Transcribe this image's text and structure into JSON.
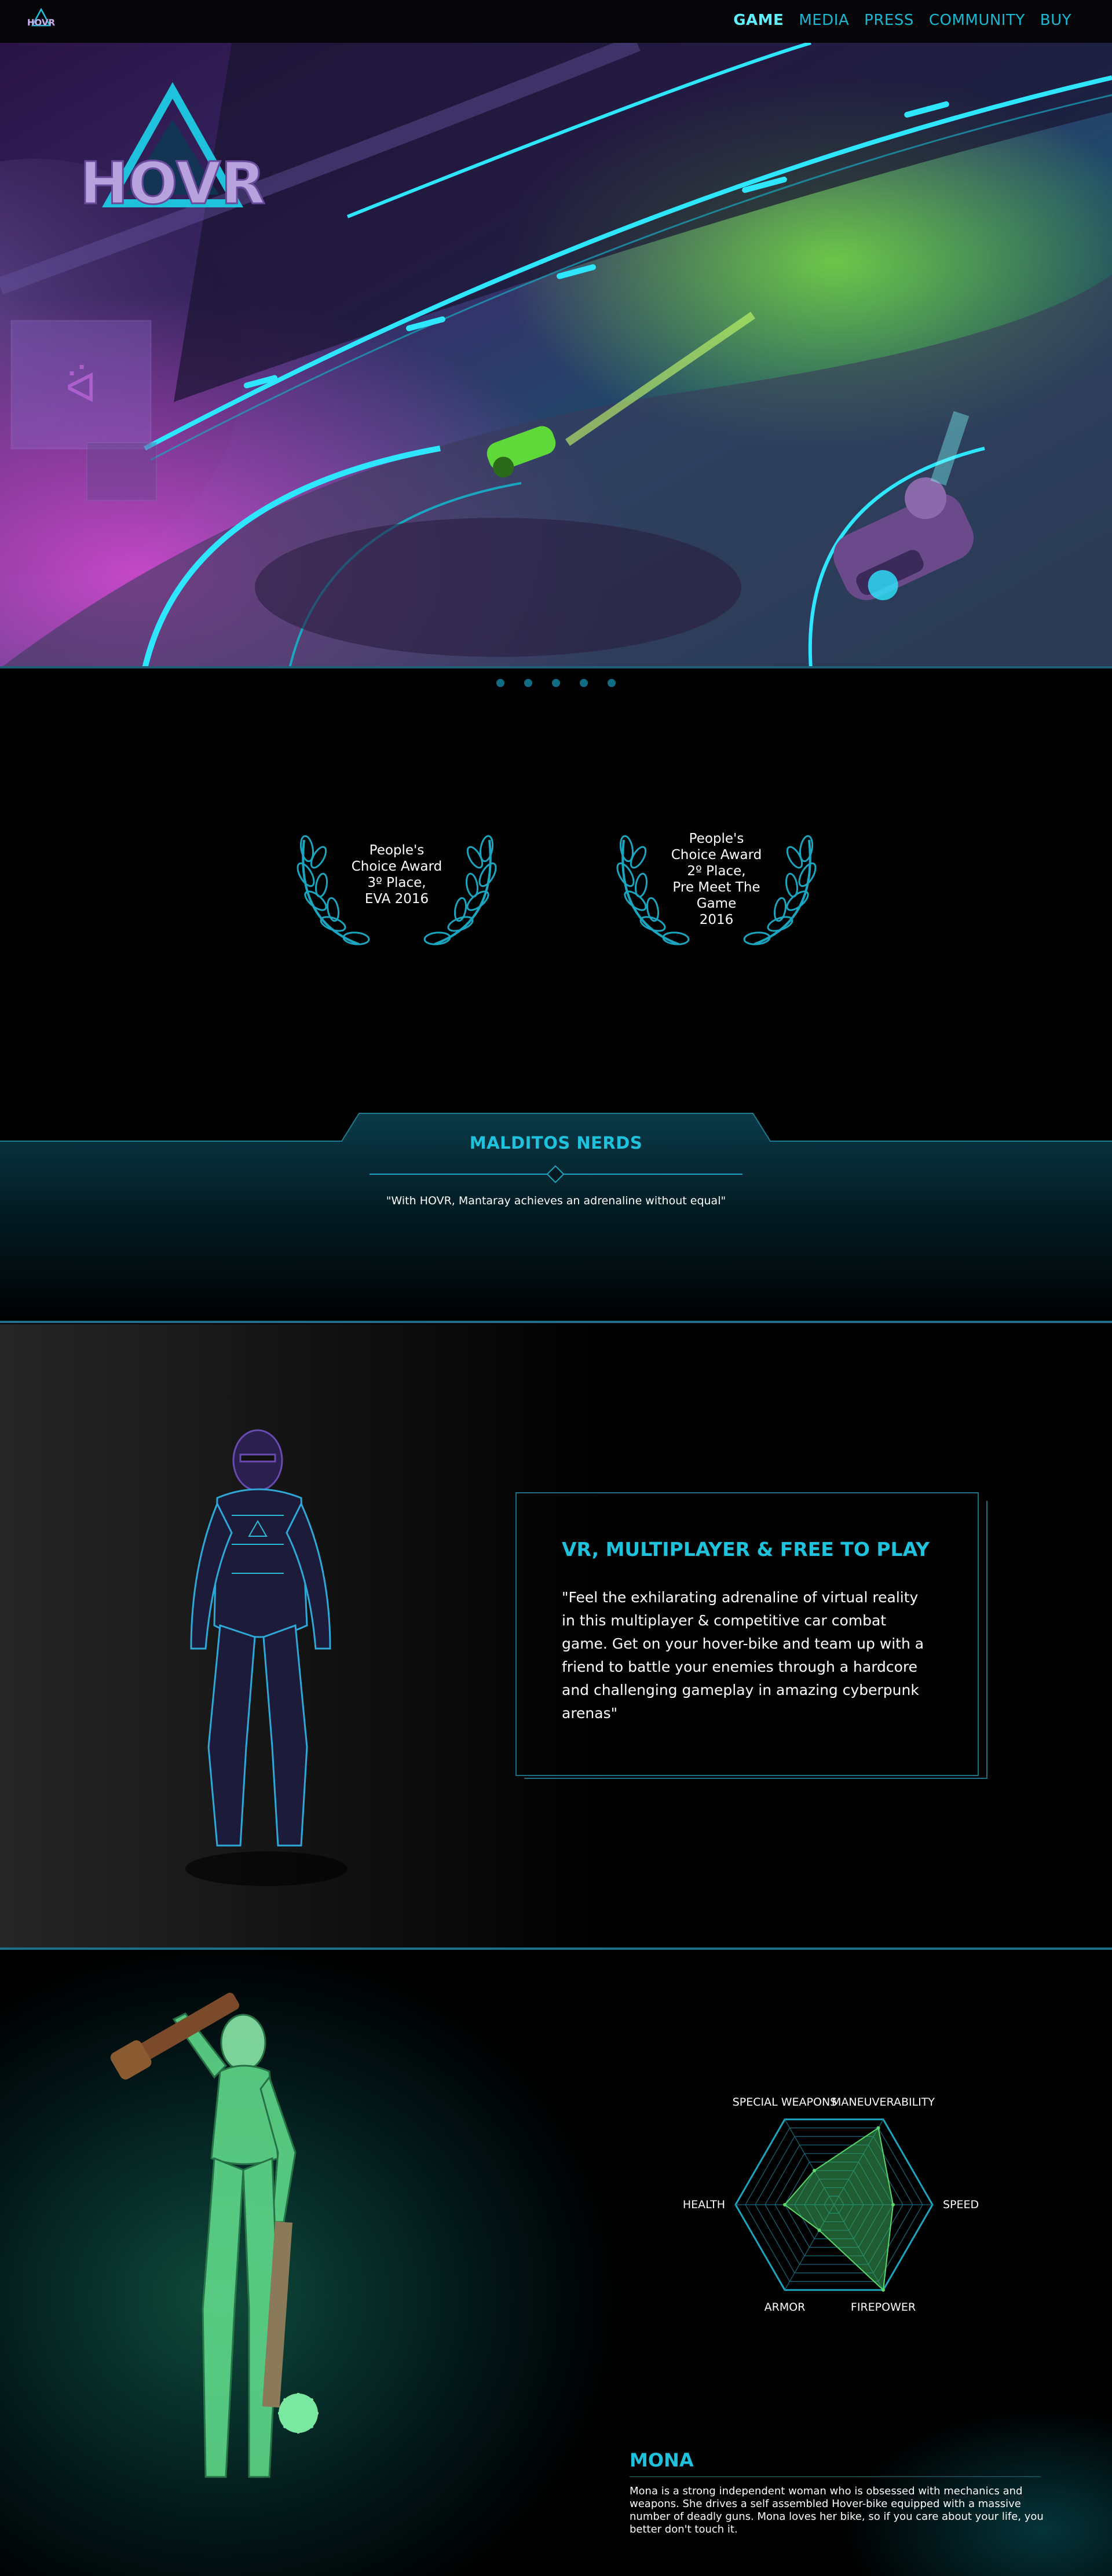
{
  "nav": {
    "logo_alt": "HOVR",
    "links": [
      "GAME",
      "MEDIA",
      "PRESS",
      "COMMUNITY",
      "BUY"
    ]
  },
  "hero": {
    "logo_text": "HOVR",
    "slides_count": 5
  },
  "awards": [
    {
      "text": "People's\nChoice Award\n3º Place,\nEVA 2016"
    },
    {
      "text": "People's\nChoice Award\n2º Place,\nPre Meet The Game\n2016"
    }
  ],
  "quote": {
    "source": "MALDITOS NERDS",
    "text": "\"With HOVR, Mantaray achieves an adrenaline without equal\""
  },
  "feature": {
    "title": "VR, MULTIPLAYER & FREE TO PLAY",
    "text": "\"Feel the exhilarating adrenaline of virtual reality in this multiplayer & competitive car combat game. Get on your hover-bike and team up with a friend to battle your enemies through a hardcore and challenging gameplay in amazing cyberpunk arenas\""
  },
  "character": {
    "name": "MONA",
    "description": "Mona is a strong independent woman who is obsessed with mechanics and weapons. She drives a self assembled Hover-bike equipped with a massive number of deadly guns. Mona loves her bike, so if you care about your life, you better don't touch it.",
    "stats_labels": [
      "SPECIAL WEAPONS",
      "MANEUVERABILITY",
      "SPEED",
      "FIREPOWER",
      "ARMOR",
      "HEALTH"
    ]
  },
  "chart_data": {
    "type": "radar",
    "categories": [
      "SPECIAL WEAPONS",
      "MANEUVERABILITY",
      "SPEED",
      "FIREPOWER",
      "ARMOR",
      "HEALTH"
    ],
    "series": [
      {
        "values": [
          4,
          9,
          6,
          10,
          3,
          5
        ]
      }
    ],
    "ylim": [
      0,
      10
    ],
    "grid": true,
    "colors": {
      "fill": "#3aa85a",
      "grid": "#1aa6c0"
    }
  },
  "colors": {
    "accent": "#1fc2dd",
    "accent_light": "#5ff0ff",
    "background": "#000000"
  }
}
